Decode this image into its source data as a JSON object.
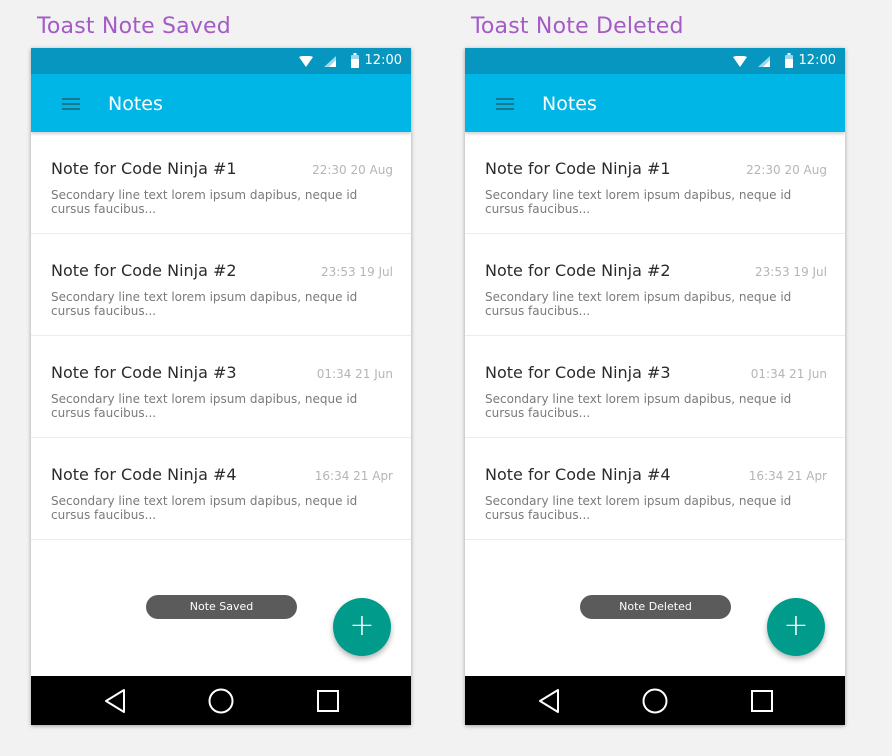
{
  "panels": [
    {
      "label": "Toast Note Saved",
      "status_time": "12:00",
      "app_title": "Notes",
      "notes": [
        {
          "title": "Note for Code Ninja #1",
          "date": "22:30 20 Aug",
          "snippet": "Secondary line text lorem ipsum dapibus, neque id cursus faucibus..."
        },
        {
          "title": "Note for Code Ninja #2",
          "date": "23:53 19 Jul",
          "snippet": "Secondary line text lorem ipsum dapibus, neque id cursus faucibus..."
        },
        {
          "title": "Note for Code Ninja #3",
          "date": "01:34 21 Jun",
          "snippet": "Secondary line text lorem ipsum dapibus, neque id cursus faucibus..."
        },
        {
          "title": "Note for Code Ninja #4",
          "date": "16:34 21 Apr",
          "snippet": "Secondary line text lorem ipsum dapibus, neque id cursus faucibus..."
        }
      ],
      "toast": "Note Saved",
      "fab": "+"
    },
    {
      "label": "Toast Note Deleted",
      "status_time": "12:00",
      "app_title": "Notes",
      "notes": [
        {
          "title": "Note for Code Ninja #1",
          "date": "22:30 20 Aug",
          "snippet": "Secondary line text lorem ipsum dapibus, neque id cursus faucibus..."
        },
        {
          "title": "Note for Code Ninja #2",
          "date": "23:53 19 Jul",
          "snippet": "Secondary line text lorem ipsum dapibus, neque id cursus faucibus..."
        },
        {
          "title": "Note for Code Ninja #3",
          "date": "01:34 21 Jun",
          "snippet": "Secondary line text lorem ipsum dapibus, neque id cursus faucibus..."
        },
        {
          "title": "Note for Code Ninja #4",
          "date": "16:34 21 Apr",
          "snippet": "Secondary line text lorem ipsum dapibus, neque id cursus faucibus..."
        }
      ],
      "toast": "Note Deleted",
      "fab": "+"
    }
  ],
  "colors": {
    "status_bar": "#0696bf",
    "app_bar": "#00b6e6",
    "fab": "#009b8a",
    "toast": "#5b5b5b",
    "panel_label": "#a45bc6"
  },
  "icons": [
    "menu-icon",
    "wifi-icon",
    "cell-signal-icon",
    "battery-icon",
    "back-icon",
    "home-icon",
    "recent-apps-icon",
    "add-icon"
  ]
}
